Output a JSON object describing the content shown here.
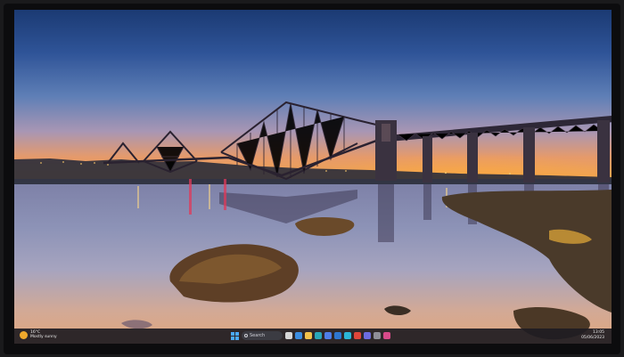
{
  "desktop": {
    "wallpaper": "Forth Bridge at sunset reflected in the water"
  },
  "taskbar": {
    "weather": {
      "icon": "sun-icon",
      "line1": "16°C",
      "line2": "Mostly sunny"
    },
    "search_placeholder": "Search",
    "apps": [
      {
        "name": "taskview-icon",
        "color": "#d6d6d6"
      },
      {
        "name": "widgets-icon",
        "color": "#3c8de0"
      },
      {
        "name": "file-explorer-icon",
        "color": "#f2c14a"
      },
      {
        "name": "edge-icon",
        "color": "#2aa6b8"
      },
      {
        "name": "store-icon",
        "color": "#4f7ee8"
      },
      {
        "name": "mail-icon",
        "color": "#2e77d0"
      },
      {
        "name": "photos-icon",
        "color": "#2bb6d6"
      },
      {
        "name": "chrome-icon",
        "color": "#e0463a"
      },
      {
        "name": "teams-icon",
        "color": "#6c6ce0"
      },
      {
        "name": "settings-icon",
        "color": "#8f8f98"
      },
      {
        "name": "app-icon",
        "color": "#d84a8a"
      }
    ],
    "clock": {
      "time": "13:05",
      "date": "05/06/2023"
    }
  }
}
